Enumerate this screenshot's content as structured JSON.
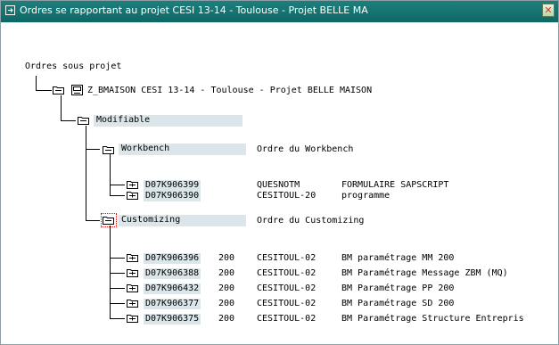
{
  "window": {
    "title": "Ordres se rapportant au projet CESI 13-14 - Toulouse - Projet BELLE MA",
    "close_glyph": "✕",
    "titlebar_color": "#0f6d6a"
  },
  "tree": {
    "root_label": "Ordres sous projet",
    "project": {
      "name": "Z_BMAISON CESI 13-14 - Toulouse - Projet BELLE MAISON"
    },
    "modifiable": {
      "label": "Modifiable"
    },
    "workbench": {
      "label": "Workbench",
      "description": "Ordre du Workbench",
      "orders": [
        {
          "id": "D07K906399",
          "client": "",
          "owner": "QUESNOTM",
          "desc": "FORMULAIRE SAPSCRIPT"
        },
        {
          "id": "D07K906390",
          "client": "",
          "owner": "CESITOUL-20",
          "desc": "programme"
        }
      ]
    },
    "customizing": {
      "label": "Customizing",
      "description": "Ordre du Customizing",
      "orders": [
        {
          "id": "D07K906396",
          "client": "200",
          "owner": "CESITOUL-02",
          "desc": "BM paramétrage MM 200"
        },
        {
          "id": "D07K906388",
          "client": "200",
          "owner": "CESITOUL-02",
          "desc": "BM Paramétrage Message ZBM (MQ)"
        },
        {
          "id": "D07K906432",
          "client": "200",
          "owner": "CESITOUL-02",
          "desc": "BM Paramétrage PP 200"
        },
        {
          "id": "D07K906377",
          "client": "200",
          "owner": "CESITOUL-02",
          "desc": "BM Paramétrage SD 200"
        },
        {
          "id": "D07K906375",
          "client": "200",
          "owner": "CESITOUL-02",
          "desc": "BM Paramétrage Structure Entrepris"
        }
      ]
    }
  },
  "colors": {
    "highlight": "#dbe6ea",
    "tree_line": "#000000",
    "selection": "#d31b1b"
  }
}
